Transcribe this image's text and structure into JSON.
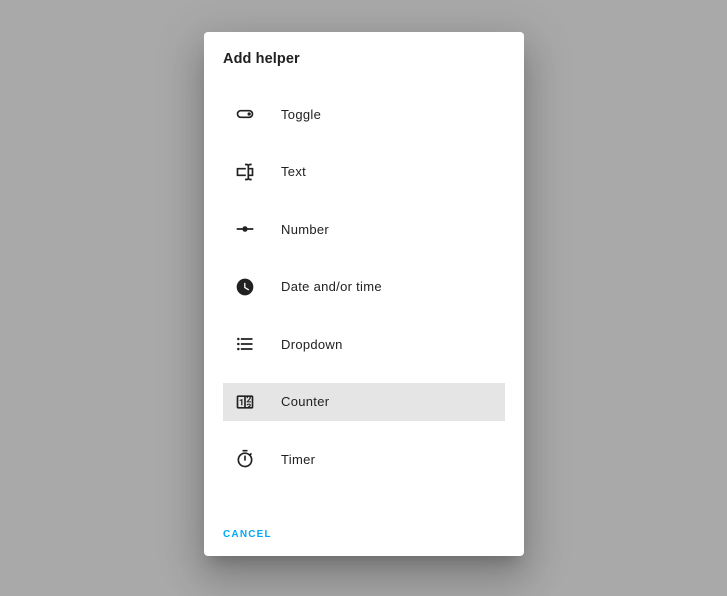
{
  "dialog": {
    "title": "Add helper",
    "items": [
      {
        "label": "Toggle",
        "icon": "toggle-switch-outline-icon"
      },
      {
        "label": "Text",
        "icon": "form-textbox-icon"
      },
      {
        "label": "Number",
        "icon": "ray-vertex-icon"
      },
      {
        "label": "Date and/or time",
        "icon": "clock-icon"
      },
      {
        "label": "Dropdown",
        "icon": "format-list-bulleted-icon"
      },
      {
        "label": "Counter",
        "icon": "counter-icon",
        "active": true
      },
      {
        "label": "Timer",
        "icon": "timer-outline-icon"
      }
    ],
    "cancel_label": "CANCEL",
    "accent_color": "#03a9f4",
    "highlight_color": "#e5e5e5"
  }
}
